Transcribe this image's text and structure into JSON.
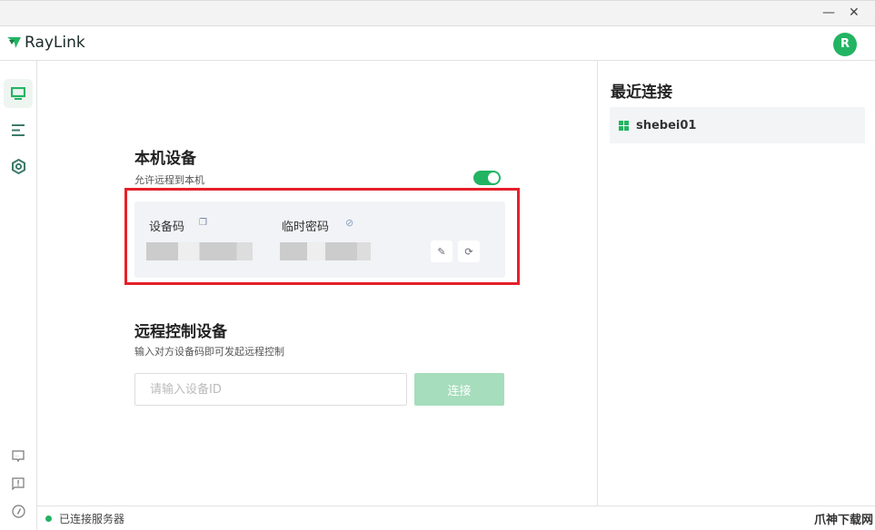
{
  "window": {
    "minimize": "—",
    "close": "✕"
  },
  "app": {
    "name": "RayLink",
    "avatar_letter": "R"
  },
  "local": {
    "title": "本机设备",
    "allow_label": "允许远程到本机",
    "allow_enabled": true,
    "device_code_label": "设备码",
    "temp_password_label": "临时密码"
  },
  "remote": {
    "title": "远程控制设备",
    "subtitle": "输入对方设备码即可发起远程控制",
    "input_placeholder": "请输入设备ID",
    "input_value": "",
    "connect_label": "连接"
  },
  "recent": {
    "title": "最近连接",
    "items": [
      {
        "name": "shebei01"
      }
    ]
  },
  "status": {
    "text": "已连接服务器"
  },
  "watermark": "爪神下载网",
  "colors": {
    "accent": "#22b462",
    "highlight": "#e5202a"
  }
}
